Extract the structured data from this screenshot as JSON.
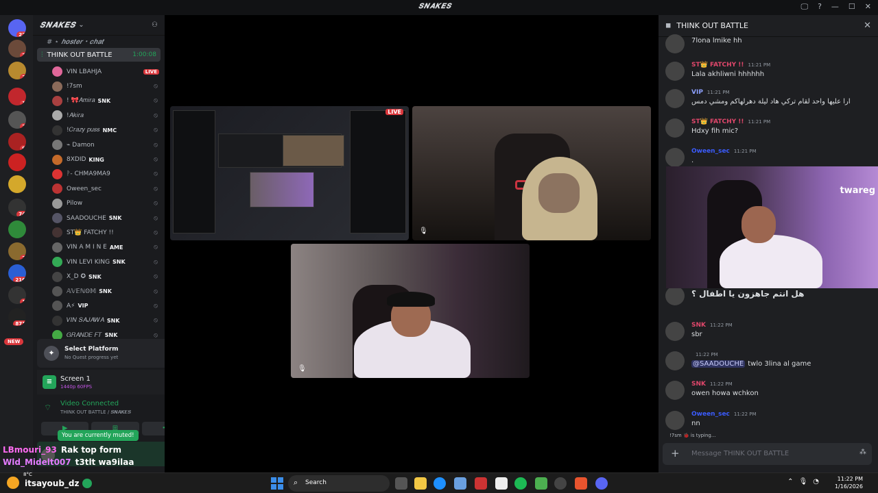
{
  "app": {
    "title": "𝑺𝑵𝑨𝑲𝑬𝑺",
    "window_controls": [
      "🖵",
      "?",
      "—",
      "☐",
      "✕"
    ]
  },
  "servers": [
    {
      "badge": "22"
    },
    {
      "badge": "2"
    },
    {
      "badge": "2"
    },
    {
      "badge": "1"
    },
    {
      "badge": "2"
    },
    {
      "badge": "9"
    },
    {
      "badge": ""
    },
    {
      "badge": ""
    },
    {
      "badge": "74"
    },
    {
      "badge": ""
    },
    {
      "badge": "2"
    },
    {
      "badge": "216"
    },
    {
      "badge": "1"
    },
    {
      "badge": "871"
    }
  ],
  "new_badge": "NEW",
  "guild": {
    "name": "𝑺𝑵𝑨𝑲𝑬𝑺",
    "hoster_channel": "# ⋆ 𝒉𝒐𝒔𝒕𝒆𝒓・𝒄𝒉𝒂𝒕"
  },
  "voice_channel": {
    "name": "THINK OUT BATTLE",
    "timer": "1:00:08"
  },
  "members": [
    {
      "name": "VIN LBAHJA",
      "tag": "",
      "live": "LIVE",
      "color": "#e0679a"
    },
    {
      "name": "!7sm",
      "tag": "",
      "live": "",
      "color": "#8a6a5a"
    },
    {
      "name": "! 🎀𝐴𝑚𝑖𝑟𝑎",
      "tag": "SNK",
      "live": "",
      "color": "#a94040"
    },
    {
      "name": "!𝐴𝑘𝑖𝑟𝑎",
      "tag": "",
      "live": "",
      "color": "#aaa"
    },
    {
      "name": "!𝐶𝑟𝑎𝑧𝑦 𝑝𝑢𝑠𝑠",
      "tag": "NMC",
      "live": "",
      "color": "#333"
    },
    {
      "name": "⌁ Damon",
      "tag": "",
      "live": "",
      "color": "#777"
    },
    {
      "name": "8XDID",
      "tag": "KING",
      "live": "",
      "color": "#c46a2a"
    },
    {
      "name": "ᚹ- CHMA9MA9",
      "tag": "",
      "live": "",
      "color": "#d33"
    },
    {
      "name": "Oween_sec",
      "tag": "",
      "live": "",
      "color": "#b33"
    },
    {
      "name": "Pilow",
      "tag": "",
      "live": "",
      "color": "#999"
    },
    {
      "name": "SAADOUCHE",
      "tag": "SNK",
      "live": "",
      "color": "#556"
    },
    {
      "name": "ST👑 FATCHY !!",
      "tag": "",
      "live": "",
      "color": "#433"
    },
    {
      "name": "VIN A M I N E",
      "tag": "AME",
      "live": "",
      "color": "#666"
    },
    {
      "name": "VIN LEVI KING",
      "tag": "SNK",
      "live": "",
      "color": "#3a5"
    },
    {
      "name": "X_D ✪",
      "tag": "SNK",
      "live": "",
      "color": "#444"
    },
    {
      "name": "𝔸𝕍𝔼ℕ𝕆𝕄",
      "tag": "SNK",
      "live": "",
      "color": "#555"
    },
    {
      "name": "A⚡",
      "tag": "VIP",
      "live": "",
      "color": "#555"
    },
    {
      "name": "𝑉𝐼𝑁 𝑆𝐴𝐽𝐴𝑊𝐴",
      "tag": "SNK",
      "live": "",
      "color": "#333"
    },
    {
      "name": "𝐺𝑅𝐴𝑁𝐷𝐸 𝐹𝑇",
      "tag": "SNK",
      "live": "",
      "color": "#4a4"
    }
  ],
  "quest": {
    "title": "Select Platform",
    "subtitle": "No Quest progress yet"
  },
  "screen_share": {
    "title": "Screen 1",
    "subtitle": "1440p 60FPS"
  },
  "voice_status": {
    "title": "Video Connected",
    "subtitle": "THINK OUT BATTLE / 𝑺𝑵𝑨𝑲𝑬𝑺"
  },
  "muted_tooltip": "You are currently muted!",
  "overlay_chat": [
    {
      "user": "LBmouri_93",
      "msg": "Rak top form"
    },
    {
      "user": "Wld_Midelt007",
      "msg": "t3tlt wa9ilaa"
    },
    {
      "user": "itsayoub_dz",
      "msg": ""
    }
  ],
  "tiles": {
    "live_label": "LIVE"
  },
  "chat": {
    "title": "THINK OUT BATTLE",
    "messages": [
      {
        "name": "",
        "time": "",
        "text": "7lona lmike hh",
        "color": "#dbdee1"
      },
      {
        "name": "ST👑 FATCHY !!",
        "time": "11:21 PM",
        "text": "Lala akhliwni hhhhhh",
        "color": "#e0476b"
      },
      {
        "name": "VIP",
        "time": "11:21 PM",
        "text": "ارا عليها واحد لقام تركي هاد ليلة دهرلهاكم ومشي دمس",
        "color": "#8da0ff"
      },
      {
        "name": "ST👑 FATCHY !!",
        "time": "11:21 PM",
        "text": "Hdxy fih mic?",
        "color": "#e0476b"
      },
      {
        "name": "Oween_sec",
        "time": "11:21 PM",
        "text": ".",
        "color": "#3b5cff"
      },
      {
        "name": "",
        "time": "",
        "text": "هل انتم جاهزون يا اطفال ؟",
        "color": "#dbdee1"
      },
      {
        "name": "SNK",
        "time": "11:22 PM",
        "text": "sbr",
        "color": "#e0476b"
      },
      {
        "name": "",
        "time": "11:22 PM",
        "text": "twlo 3lina al game",
        "mention": "@SAADOUCHE",
        "color": "#e0476b"
      },
      {
        "name": "SNK",
        "time": "11:22 PM",
        "text": "owen howa wchkon",
        "color": "#e0476b"
      },
      {
        "name": "Oween_sec",
        "time": "11:22 PM",
        "text": "nn",
        "color": "#3b5cff"
      }
    ],
    "typing": "!7sm 🐞 is typing...",
    "input_placeholder": "Message THINK OUT BATTLE",
    "image_brand": "twareg"
  },
  "taskbar": {
    "temp": "8°C",
    "search_label": "Search",
    "time": "11:22 PM",
    "date": "1/16/2026"
  }
}
